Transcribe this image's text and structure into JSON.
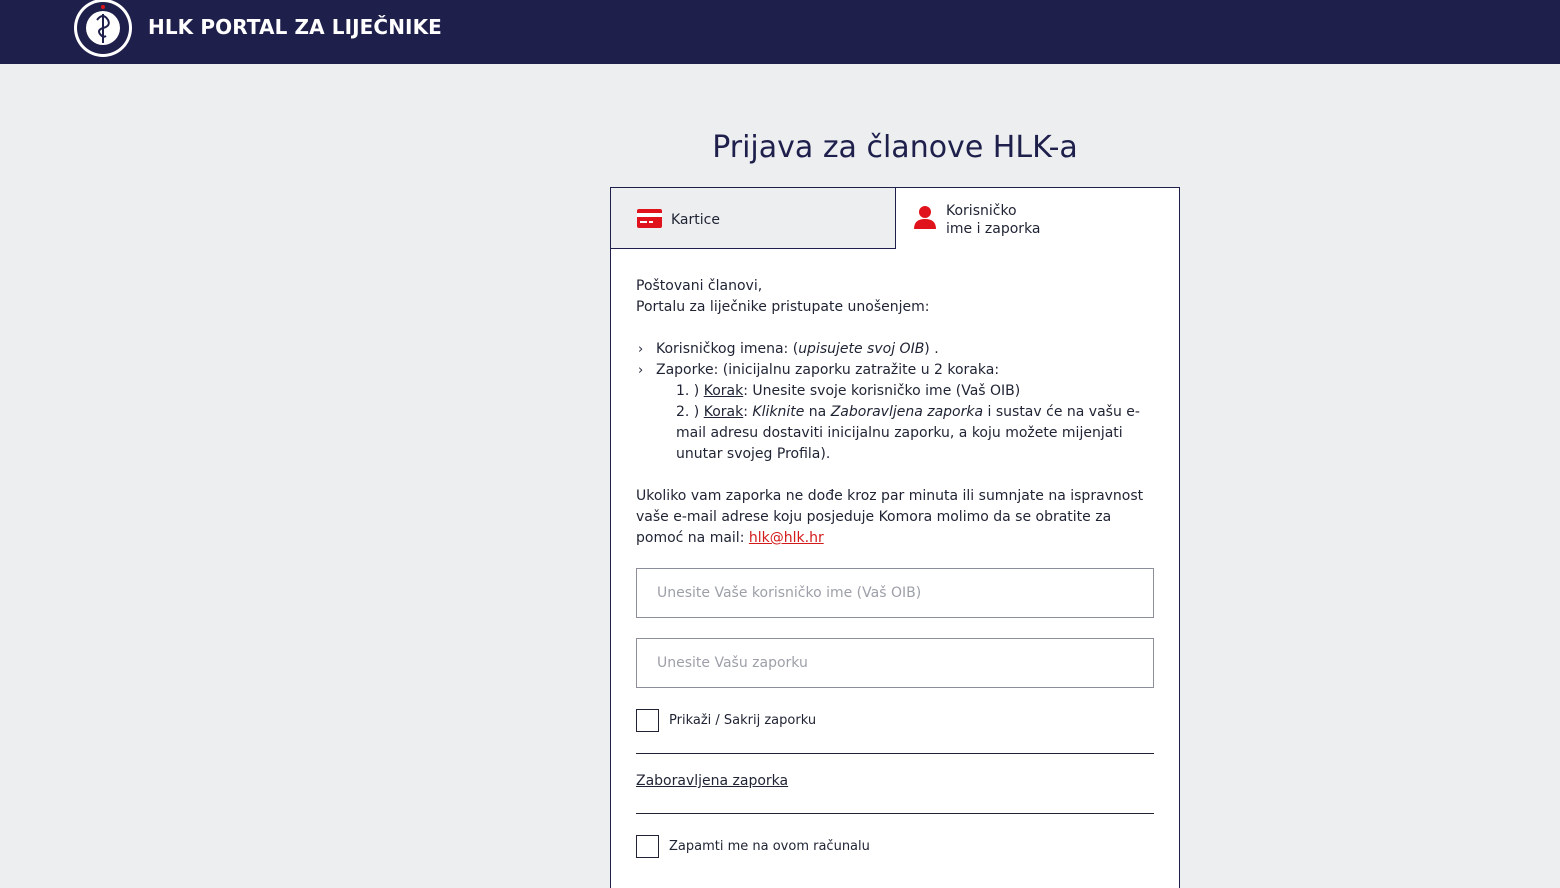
{
  "header": {
    "brand": "HLK PORTAL ZA LIJEČNIKE",
    "logo_icon": "hlk-seal-logo",
    "background": "#1e1f4b"
  },
  "page": {
    "title": "Prijava za članove HLK-a"
  },
  "tabs": [
    {
      "label": "Kartice",
      "icon": "credit-card-icon",
      "active": false
    },
    {
      "label_line1": "Korisničko",
      "label_line2": "ime i zaporka",
      "icon": "user-icon",
      "active": true
    }
  ],
  "info": {
    "greeting": "Poštovani članovi,",
    "intro": "Portalu za liječnike pristupate unošenjem:",
    "bullet1_prefix": "Korisničkog imena: (",
    "bullet1_italic": "upisujete svoj OIB",
    "bullet1_suffix": ") .",
    "bullet2": "Zaporke: (inicijalnu zaporku zatražite u 2 koraka:",
    "step1_num": "1. ) ",
    "step1_word": "Korak",
    "step1_text": ": Unesite svoje korisničko ime (Vaš OIB)",
    "step2_num": "2. ) ",
    "step2_word": "Korak",
    "step2_colon": ": ",
    "step2_italic1": "Kliknite",
    "step2_na": " na ",
    "step2_italic2": "Zaboravljena zaporka",
    "step2_text": " i sustav će na vašu e-mail adresu dostaviti inicijalnu zaporku, a koju možete mijenjati unutar svojeg Profila).",
    "help_text": "Ukoliko vam zaporka ne dođe kroz par minuta ili sumnjate na ispravnost vaše e-mail adrese koju posjeduje Komora molimo da se obratite za pomoć na mail: ",
    "help_email": "hlk@hlk.hr"
  },
  "form": {
    "username_placeholder": "Unesite Vaše korisničko ime (Vaš OIB)",
    "username_value": "",
    "password_placeholder": "Unesite Vašu zaporku",
    "password_value": "",
    "show_password_label": "Prikaži / Sakrij zaporku",
    "forgot_label": "Zaboravljena zaporka",
    "remember_label": "Zapamti me na ovom računalu"
  },
  "colors": {
    "accent_red": "#e0121b",
    "navy": "#1e1f4b"
  }
}
